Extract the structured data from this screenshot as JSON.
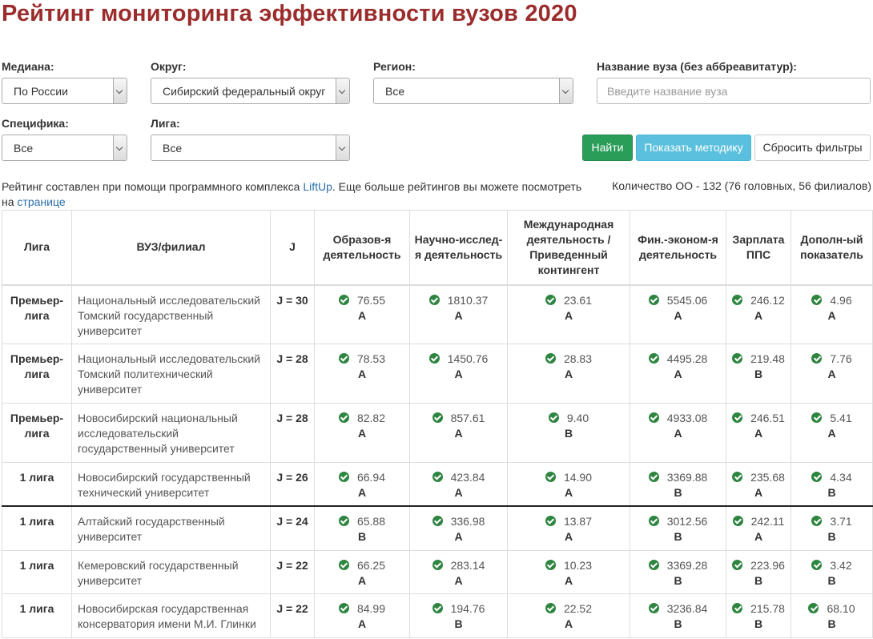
{
  "page": {
    "title": "Рейтинг мониторинга эффективности вузов 2020"
  },
  "filters": {
    "median": {
      "label": "Медиана:",
      "value": "По России"
    },
    "district": {
      "label": "Округ:",
      "value": "Сибирский федеральный округ"
    },
    "region": {
      "label": "Регион:",
      "value": "Все"
    },
    "name": {
      "label": "Название вуза (без аббреавитатур):",
      "placeholder": "Введите название вуза"
    },
    "specifics": {
      "label": "Специфика:",
      "value": "Все"
    },
    "league": {
      "label": "Лига:",
      "value": "Все"
    }
  },
  "buttons": {
    "find": "Найти",
    "method": "Показать методику",
    "reset": "Сбросить фильтры"
  },
  "info": {
    "text1": "Рейтинг составлен при помощи программного комплекса ",
    "link1": "LiftUp",
    "text2": ". Еще больше рейтингов вы можете посмотреть на ",
    "link2": "странице",
    "count": "Количество ОО - 132 (76 головных, 56 филиалов)"
  },
  "table": {
    "headers": [
      "Лига",
      "ВУЗ/филиал",
      "J",
      "Образов-я деятельность",
      "Научно-исслед-я деятельность",
      "Международная деятельность /Приведенный контингент",
      "Фин.-эконом-я деятельность",
      "Зарплата ППС",
      "Дополн-ый показатель"
    ],
    "rows": [
      {
        "league": "Премьер-лига",
        "name": "Национальный исследовательский Томский государственный университет",
        "j": "J = 30",
        "cells": [
          [
            "76.55",
            "A"
          ],
          [
            "1810.37",
            "A"
          ],
          [
            "23.61",
            "A"
          ],
          [
            "5545.06",
            "A"
          ],
          [
            "246.12",
            "A"
          ],
          [
            "4.96",
            "A"
          ]
        ]
      },
      {
        "league": "Премьер-лига",
        "name": "Национальный исследовательский Томский политехнический университет",
        "j": "J = 28",
        "cells": [
          [
            "78.53",
            "A"
          ],
          [
            "1450.76",
            "A"
          ],
          [
            "28.83",
            "A"
          ],
          [
            "4495.28",
            "A"
          ],
          [
            "219.48",
            "B"
          ],
          [
            "7.76",
            "A"
          ]
        ]
      },
      {
        "league": "Премьер-лига",
        "name": "Новосибирский национальный исследовательский государственный университет",
        "j": "J = 28",
        "cells": [
          [
            "82.82",
            "A"
          ],
          [
            "857.61",
            "A"
          ],
          [
            "9.40",
            "B"
          ],
          [
            "4933.08",
            "A"
          ],
          [
            "246.51",
            "A"
          ],
          [
            "5.41",
            "A"
          ]
        ]
      },
      {
        "league": "1 лига",
        "name": "Новосибирский государственный технический университет",
        "j": "J = 26",
        "cells": [
          [
            "66.94",
            "A"
          ],
          [
            "423.84",
            "A"
          ],
          [
            "14.90",
            "A"
          ],
          [
            "3369.88",
            "B"
          ],
          [
            "235.68",
            "A"
          ],
          [
            "4.34",
            "B"
          ]
        ]
      },
      {
        "league": "1 лига",
        "name": "Алтайский государственный университет",
        "j": "J = 24",
        "cells": [
          [
            "65.88",
            "B"
          ],
          [
            "336.98",
            "A"
          ],
          [
            "13.87",
            "A"
          ],
          [
            "3012.56",
            "B"
          ],
          [
            "242.11",
            "A"
          ],
          [
            "3.71",
            "B"
          ]
        ]
      },
      {
        "league": "1 лига",
        "name": "Кемеровский государственный университет",
        "j": "J = 22",
        "cells": [
          [
            "66.25",
            "A"
          ],
          [
            "283.14",
            "A"
          ],
          [
            "10.23",
            "A"
          ],
          [
            "3369.28",
            "B"
          ],
          [
            "223.96",
            "B"
          ],
          [
            "3.42",
            "B"
          ]
        ]
      },
      {
        "league": "1 лига",
        "name": "Новосибирская государственная консерватория имени М.И. Глинки",
        "j": "J = 22",
        "cells": [
          [
            "84.99",
            "A"
          ],
          [
            "194.76",
            "B"
          ],
          [
            "22.52",
            "A"
          ],
          [
            "3236.84",
            "B"
          ],
          [
            "215.78",
            "B"
          ],
          [
            "68.10",
            "B"
          ]
        ]
      }
    ]
  },
  "colors": {
    "title": "#9b2c2c",
    "find_button": "#2a9d59",
    "method_button": "#5bc0de",
    "check_icon": "#2e8540",
    "link": "#2a6ea8"
  }
}
